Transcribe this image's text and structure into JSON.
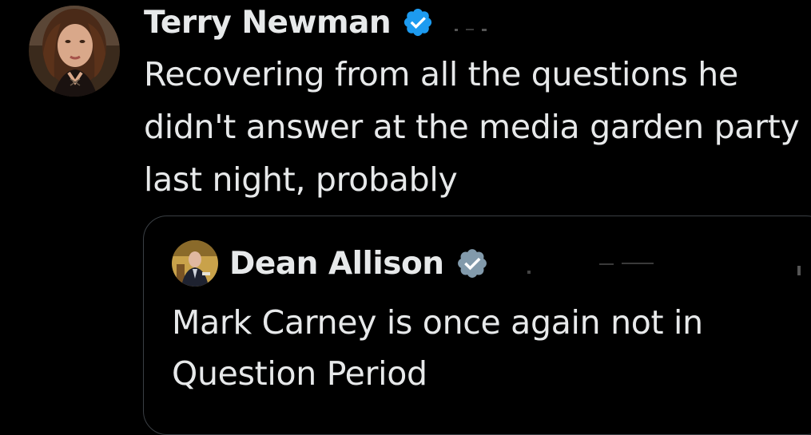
{
  "tweet": {
    "author": {
      "name": "Terry Newman",
      "verified": true,
      "badge_color": "#1d9bf0",
      "avatar_icon": "profile-photo"
    },
    "text": "Recovering from all the questions he didn't answer at the media garden party last night, probably"
  },
  "quoted_tweet": {
    "author": {
      "name": "Dean Allison",
      "verified": true,
      "badge_color": "#829aab",
      "avatar_icon": "profile-photo"
    },
    "text": "Mark Carney is once again not in Question Period"
  },
  "theme": {
    "background": "#000000",
    "text_color": "#e7e9ea",
    "card_border": "#3a3f44"
  }
}
